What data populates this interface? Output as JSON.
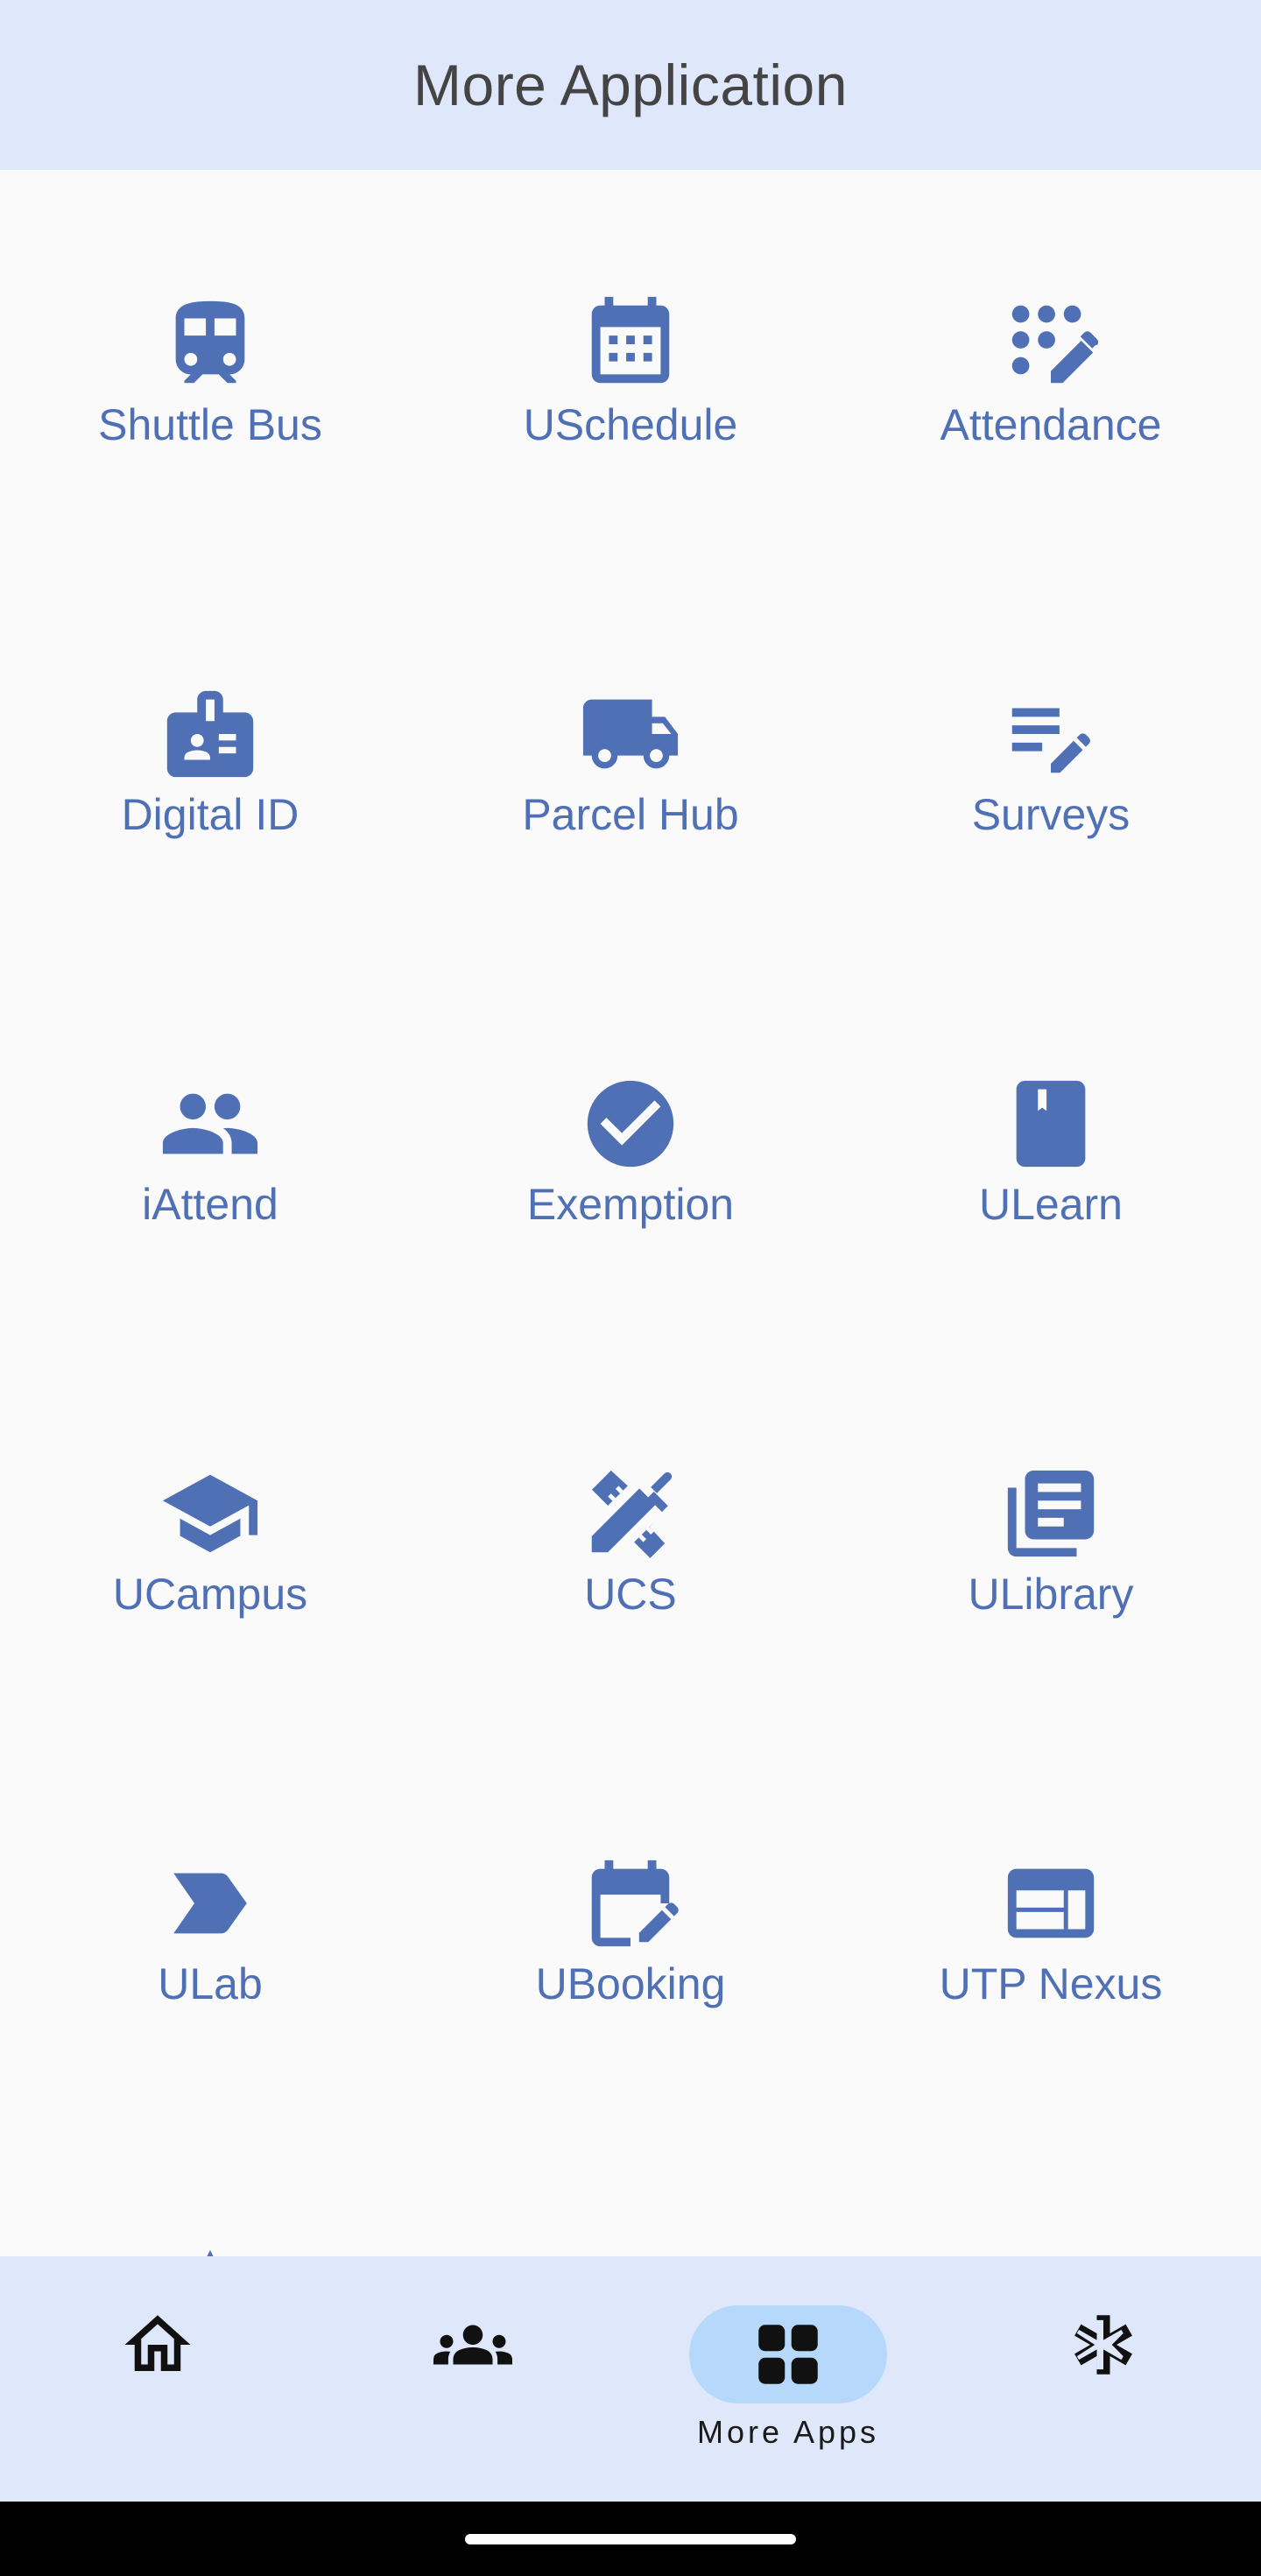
{
  "header": {
    "title": "More Application"
  },
  "colors": {
    "accent": "#4f70b5",
    "header_bg": "#dfe7fb",
    "active_pill": "#b5d8fb"
  },
  "apps": [
    {
      "label": "Shuttle Bus",
      "icon": "train-icon"
    },
    {
      "label": "USchedule",
      "icon": "calendar-icon"
    },
    {
      "label": "Attendance",
      "icon": "dialpad-edit-icon"
    },
    {
      "label": "Digital ID",
      "icon": "badge-icon"
    },
    {
      "label": "Parcel Hub",
      "icon": "truck-icon"
    },
    {
      "label": "Surveys",
      "icon": "edit-note-icon"
    },
    {
      "label": "iAttend",
      "icon": "people-icon"
    },
    {
      "label": "Exemption",
      "icon": "check-circle-icon"
    },
    {
      "label": "ULearn",
      "icon": "book-icon"
    },
    {
      "label": "UCampus",
      "icon": "school-icon"
    },
    {
      "label": "UCS",
      "icon": "design-tools-icon"
    },
    {
      "label": "ULibrary",
      "icon": "library-books-icon"
    },
    {
      "label": "ULab",
      "icon": "label-chevron-icon"
    },
    {
      "label": "UBooking",
      "icon": "edit-calendar-icon"
    },
    {
      "label": "UTP Nexus",
      "icon": "web-icon"
    },
    {
      "label": "",
      "icon": "partial-icon"
    },
    {
      "label": "",
      "icon": "partial-icon"
    }
  ],
  "bottom_nav": {
    "items": [
      {
        "name": "home",
        "icon": "home-icon",
        "label": ""
      },
      {
        "name": "community",
        "icon": "groups-icon",
        "label": ""
      },
      {
        "name": "more-apps",
        "icon": "apps-grid-icon",
        "label": "More Apps",
        "active": true
      },
      {
        "name": "medical",
        "icon": "medical-star-icon",
        "label": ""
      }
    ]
  }
}
